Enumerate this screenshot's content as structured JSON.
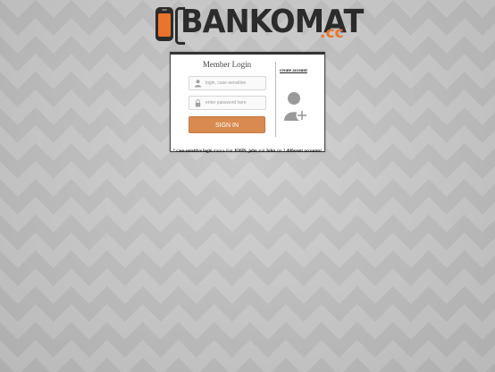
{
  "logo": {
    "brand": "BANKOMAT",
    "tld": ".cc"
  },
  "login": {
    "title": "Member Login",
    "username_placeholder": "login, case-sensitive",
    "password_placeholder": "enter password here",
    "username_icon": "user-icon",
    "password_icon": "lock-icon",
    "signin_label": "SIGN IN"
  },
  "register": {
    "create_account_label": "create account",
    "icon": "add-user-icon"
  },
  "notice": {
    "prefix": "* ",
    "term": "case-sensitive login",
    "mid1": " means that ",
    "example1": "JOHN",
    "sep1": ", ",
    "example2": "john",
    "mid2": " and ",
    "example3": "John",
    "mid3": " are 3 ",
    "emphasis": "different accounts",
    "suffix": "!"
  },
  "colors": {
    "accent": "#e9742d",
    "button": "#d98a50",
    "dark": "#2b2b2b"
  }
}
